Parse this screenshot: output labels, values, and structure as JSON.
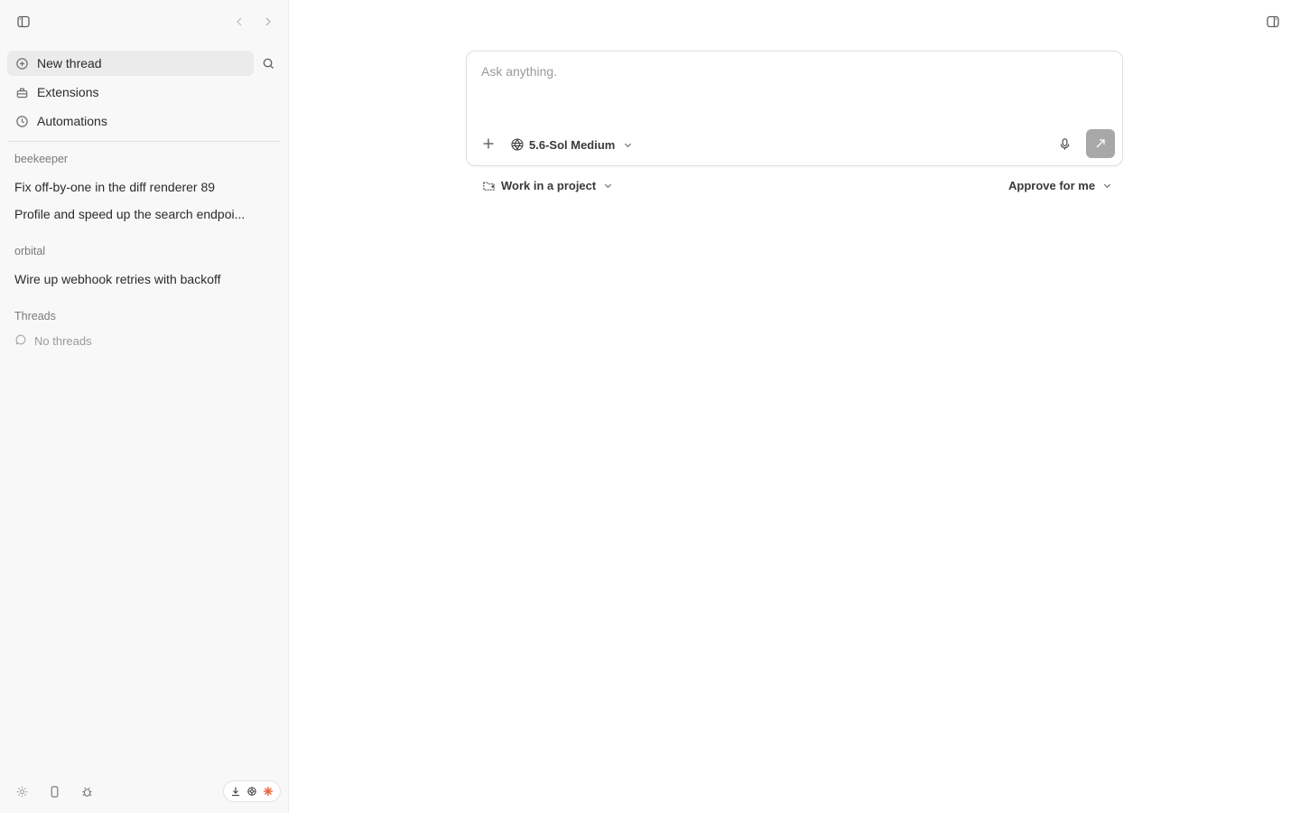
{
  "sidebar": {
    "nav": [
      {
        "label": "New thread",
        "icon": "new-thread-icon"
      },
      {
        "label": "Extensions",
        "icon": "extensions-icon"
      },
      {
        "label": "Automations",
        "icon": "clock-icon"
      }
    ],
    "groups": [
      {
        "name": "beekeeper",
        "threads": [
          "Fix off-by-one in the diff renderer 89",
          "Profile and speed up the search endpoi..."
        ]
      },
      {
        "name": "orbital",
        "threads": [
          "Wire up webhook retries with backoff"
        ]
      }
    ],
    "threads_section": {
      "label": "Threads",
      "empty_text": "No threads"
    }
  },
  "composer": {
    "placeholder": "Ask anything.",
    "model_label": "5.6-Sol Medium"
  },
  "project_selector": {
    "label": "Work in a project"
  },
  "approval_selector": {
    "label": "Approve for me"
  },
  "colors": {
    "sidebar_bg": "#f8f8f8",
    "active_item_bg": "#ebebeb",
    "send_button": "#a8a8a8",
    "tray_accent": "#e8663d"
  }
}
